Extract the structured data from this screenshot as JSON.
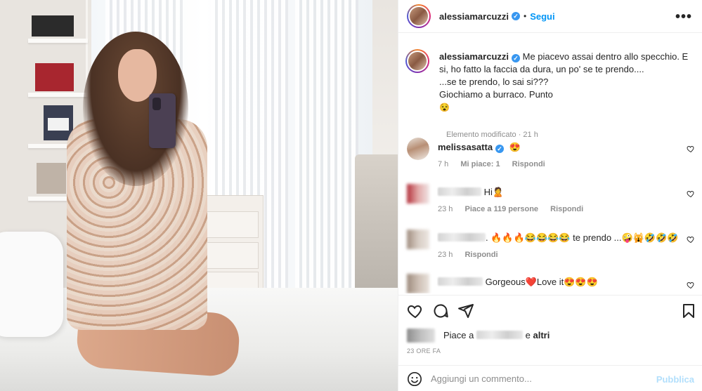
{
  "post": {
    "username": "alessiamarcuzzi",
    "verified": true,
    "separator": "•",
    "follow_label": "Segui",
    "more_label": "•••"
  },
  "caption": {
    "username": "alessiamarcuzzi",
    "text_line1": "Me piacevo assai dentro allo specchio. E si, ho fatto la faccia da dura, un po' se te prendo....",
    "text_line2": "...se te prendo, lo sai si???",
    "text_line3": "Giochiamo a burraco. Punto",
    "text_emoji": "😵",
    "meta": "Elemento modificato · 21 h"
  },
  "comments": [
    {
      "username": "melissasatta",
      "verified": true,
      "text": "😍",
      "time": "7 h",
      "likes": "Mi piace: 1",
      "reply": "Rispondi",
      "username_hidden": false
    },
    {
      "username": "",
      "text": "Hi🙎",
      "time": "23 h",
      "likes": "Piace a 119 persone",
      "reply": "Rispondi",
      "username_hidden": true
    },
    {
      "username": "",
      "text": ". 🔥🔥🔥😂😂😂😂 te prendo ...🤪🙀🤣🤣🤣",
      "time": "23 h",
      "likes": "",
      "reply": "Rispondi",
      "username_hidden": true
    },
    {
      "username": "",
      "text": "Gorgeous❤️Love it😍😍😍",
      "time": "",
      "likes": "",
      "reply": "",
      "username_hidden": true
    }
  ],
  "likes_bar": {
    "prefix": "Piace a",
    "suffix": "e",
    "others": "altri"
  },
  "timestamp": "23 ORE FA",
  "add_comment": {
    "placeholder": "Aggiungi un commento...",
    "publish_label": "Pubblica"
  },
  "colors": {
    "link_blue": "#0095f6",
    "verified_blue": "#3897f0",
    "meta_gray": "#8e8e8e",
    "publish_disabled": "#b2dffc"
  },
  "icons": [
    "heart-icon",
    "comment-icon",
    "share-icon",
    "bookmark-icon",
    "emoji-icon",
    "more-options-icon",
    "verified-icon"
  ]
}
